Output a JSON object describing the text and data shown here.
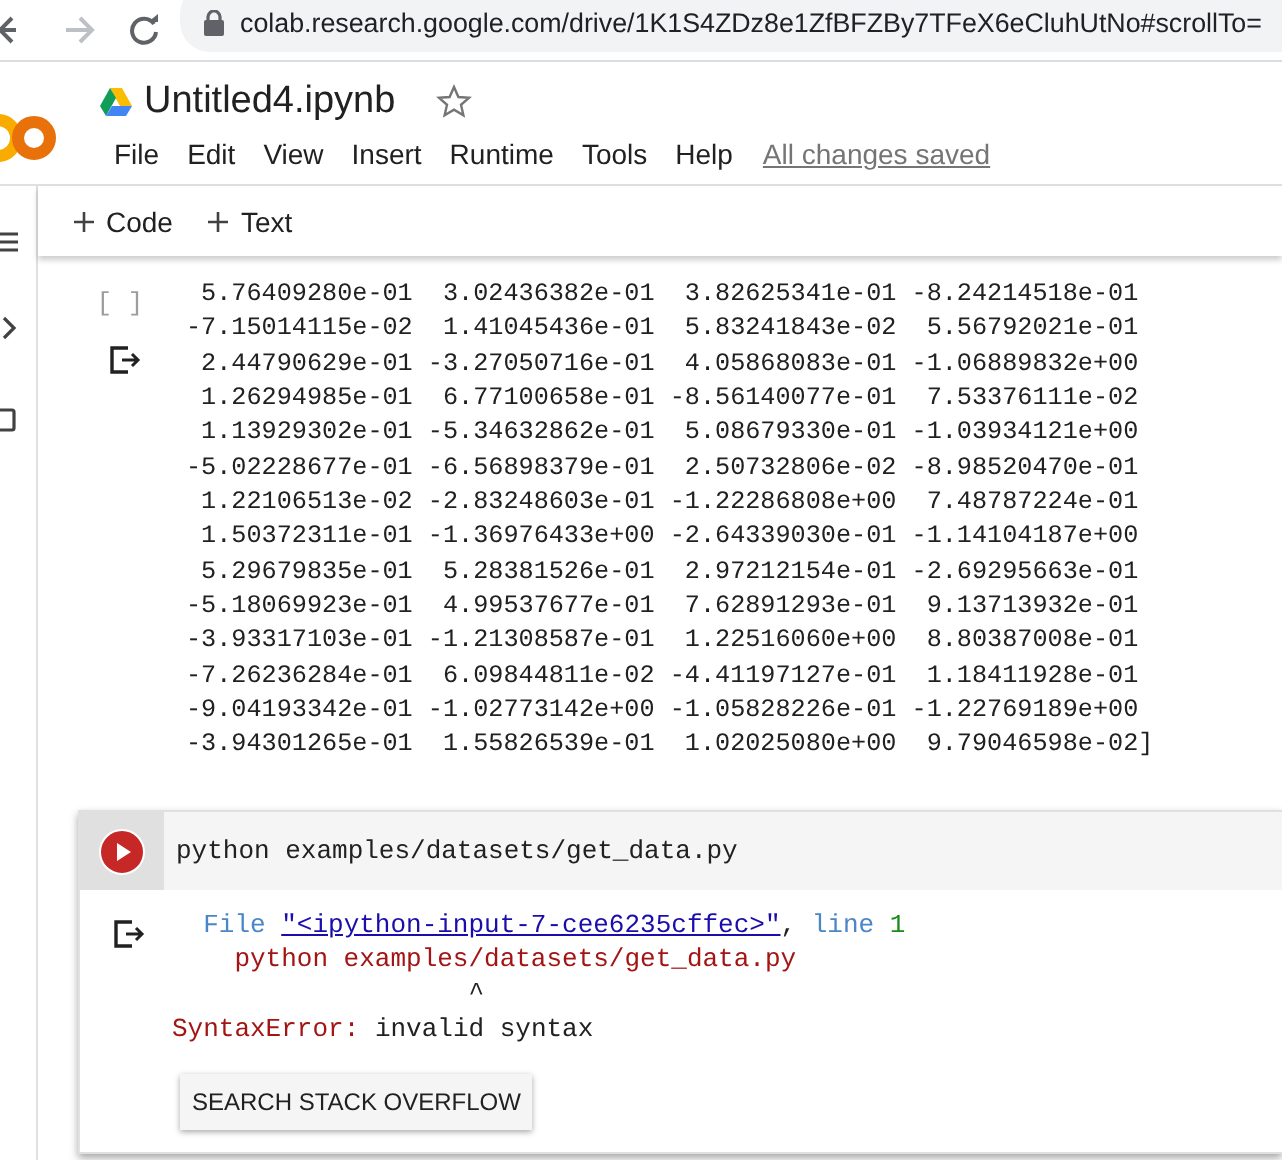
{
  "browser": {
    "url": "colab.research.google.com/drive/1K1S4ZDz8e1ZfBFZBy7TFeX6eCluhUtNo#scrollTo="
  },
  "notebook": {
    "title": "Untitled4.ipynb",
    "starred": false
  },
  "menu": [
    "File",
    "Edit",
    "View",
    "Insert",
    "Runtime",
    "Tools",
    "Help"
  ],
  "save_status": "All changes saved",
  "toolbar": [
    "Code",
    "Text"
  ],
  "output_cell": {
    "prompt": "[ ]",
    "lines": [
      " 5.76409280e-01  3.02436382e-01  3.82625341e-01 -8.24214518e-01",
      "-7.15014115e-02  1.41045436e-01  5.83241843e-02  5.56792021e-01",
      " 2.44790629e-01 -3.27050716e-01  4.05868083e-01 -1.06889832e+00",
      " 1.26294985e-01  6.77100658e-01 -8.56140077e-01  7.53376111e-02",
      " 1.13929302e-01 -5.34632862e-01  5.08679330e-01 -1.03934121e+00",
      "-5.02228677e-01 -6.56898379e-01  2.50732806e-02 -8.98520470e-01",
      " 1.22106513e-02 -2.83248603e-01 -1.22286808e+00  7.48787224e-01",
      " 1.50372311e-01 -1.36976433e+00 -2.64339030e-01 -1.14104187e+00",
      " 5.29679835e-01  5.28381526e-01  2.97212154e-01 -2.69295663e-01",
      "-5.18069923e-01  4.99537677e-01  7.62891293e-01  9.13713932e-01",
      "-3.93317103e-01 -1.21308587e-01  1.22516060e+00  8.80387008e-01",
      "-7.26236284e-01  6.09844811e-02 -4.41197127e-01  1.18411928e-01",
      "-9.04193342e-01 -1.02773142e+00 -1.05828226e-01 -1.22769189e+00",
      "-3.94301265e-01  1.55826539e-01  1.02025080e+00  9.79046598e-02]"
    ]
  },
  "code_cell": {
    "code": "python examples/datasets/get_data.py",
    "traceback": [
      {
        "kind": "keyword",
        "text": "File"
      },
      {
        "kind": "link",
        "text": "\"<ipython-input-7-cee6235cffec>\""
      },
      {
        "kind": "plain",
        "text": ","
      },
      {
        "kind": "keyword",
        "text": "line"
      },
      {
        "kind": "number",
        "text": "1"
      }
    ],
    "source_line": "python examples/datasets/get_data.py",
    "caret": "^",
    "error": {
      "type": "SyntaxError:",
      "message": "invalid syntax"
    },
    "button": "SEARCH STACK OVERFLOW"
  }
}
